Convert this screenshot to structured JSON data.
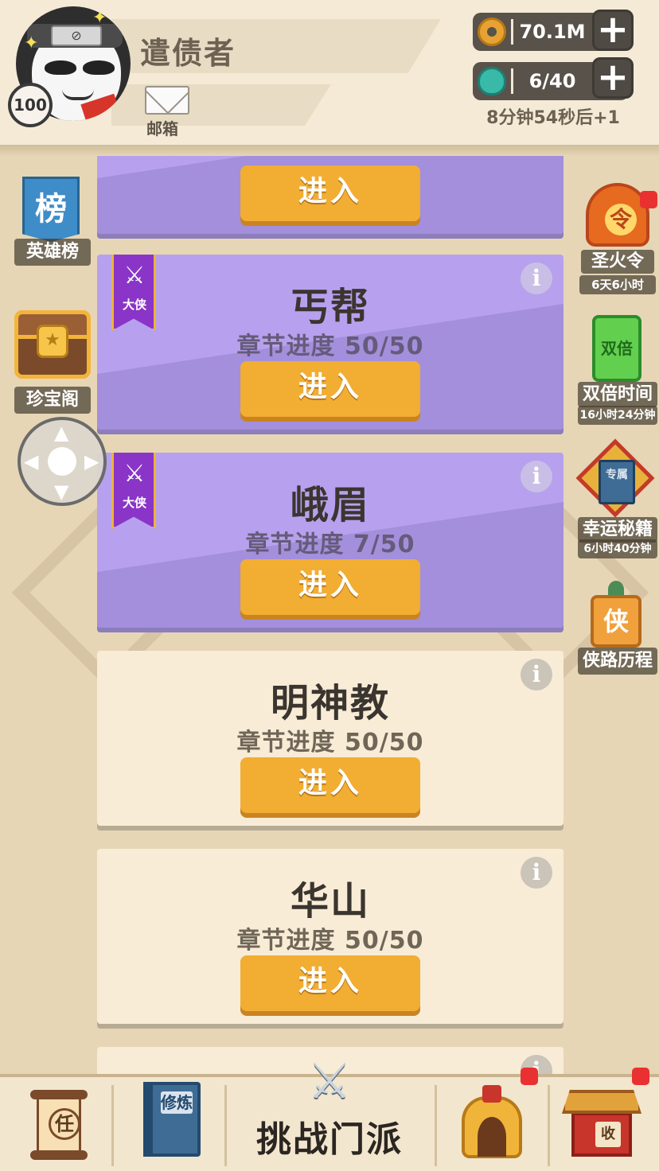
{
  "player": {
    "name": "遣债者",
    "level": "100",
    "avatar_plate": "⊘"
  },
  "mail": {
    "label": "邮箱"
  },
  "resources": {
    "coins": "70.1M",
    "stamina": "6/40",
    "stamina_timer": "8分钟54秒后+1",
    "plus_symbol": "+"
  },
  "side_left": {
    "hero_rank": {
      "icon_text": "榜",
      "label": "英雄榜"
    },
    "treasure": {
      "label": "珍宝阁"
    }
  },
  "side_right": {
    "holy_fire": {
      "icon_text": "令",
      "label": "圣火令",
      "timer": "6天6小时"
    },
    "double_time": {
      "icon_text": "双倍",
      "label": "双倍时间",
      "timer": "16小时24分钟"
    },
    "lucky_manual": {
      "icon_text": "专属",
      "label": "幸运秘籍",
      "timer": "6小时40分钟"
    },
    "hero_journey": {
      "icon_text": "侠",
      "label": "侠路历程"
    }
  },
  "sects": [
    {
      "name": "",
      "progress": "",
      "enter": "进入",
      "style": "purple",
      "badge": false
    },
    {
      "name": "丐帮",
      "progress": "章节进度 50/50",
      "enter": "进入",
      "style": "purple",
      "badge": true,
      "badge_label": "大侠"
    },
    {
      "name": "峨眉",
      "progress": "章节进度 7/50",
      "enter": "进入",
      "style": "purple",
      "badge": true,
      "badge_label": "大侠"
    },
    {
      "name": "明神教",
      "progress": "章节进度 50/50",
      "enter": "进入",
      "style": "cream",
      "badge": false
    },
    {
      "name": "华山",
      "progress": "章节进度 50/50",
      "enter": "进入",
      "style": "cream",
      "badge": false
    }
  ],
  "info_symbol": "i",
  "bottom_nav": {
    "task_icon_text": "任",
    "cultivate_icon_text": "修炼",
    "challenge_label": "挑战门派",
    "collect_icon_text": "收"
  },
  "colors": {
    "purple_card": "#b7a1ee",
    "cream_card": "#f8ecd6",
    "enter_button": "#f2ad33",
    "notification": "#ea3131"
  }
}
